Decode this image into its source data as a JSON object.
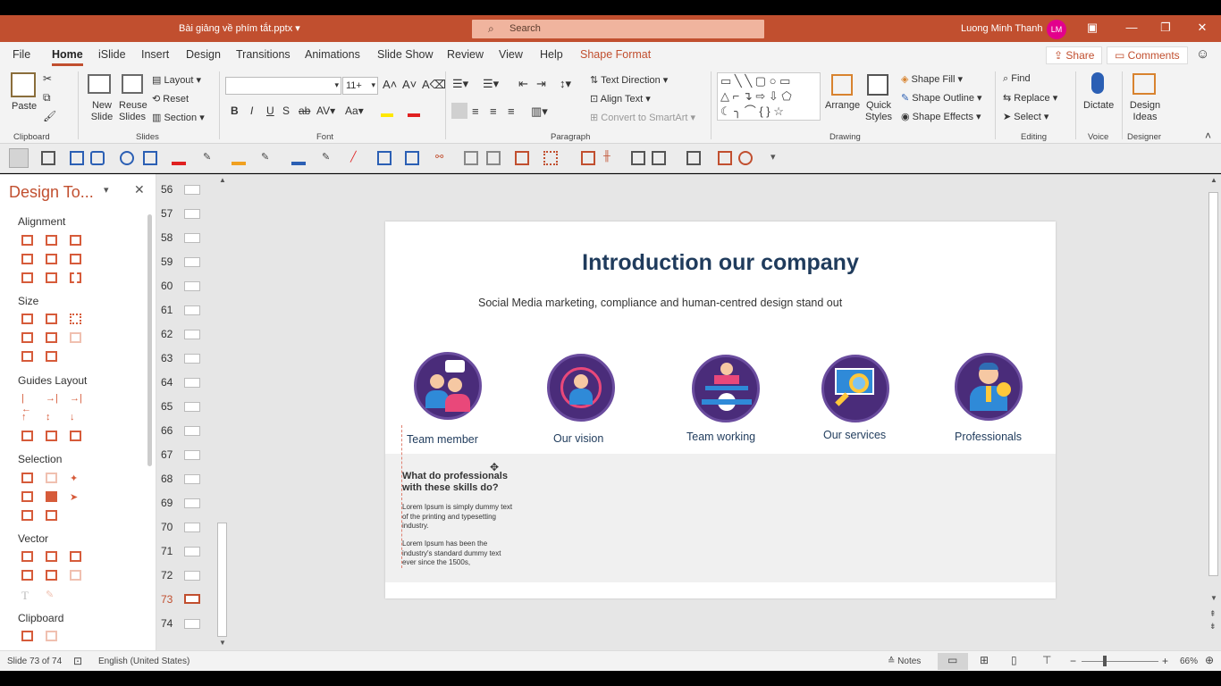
{
  "titlebar": {
    "filename": "Bài giảng về phím tắt.pptx",
    "dropdown_icon": "chevron-down-icon",
    "search_placeholder": "Search",
    "user_name": "Luong Minh Thanh",
    "user_initials": "LM",
    "accent": "#c14f2f"
  },
  "tabs": [
    "File",
    "Home",
    "iSlide",
    "Insert",
    "Design",
    "Transitions",
    "Animations",
    "Slide Show",
    "Review",
    "View",
    "Help",
    "Shape Format"
  ],
  "active_tab": "Home",
  "share_label": "Share",
  "comments_label": "Comments",
  "ribbon": {
    "clipboard": {
      "paste": "Paste",
      "group": "Clipboard"
    },
    "slides": {
      "new_slide": "New Slide",
      "reuse_slides": "Reuse Slides",
      "layout": "Layout",
      "reset": "Reset",
      "section": "Section",
      "group": "Slides"
    },
    "font": {
      "size": "11+",
      "bold": "B",
      "italic": "I",
      "underline": "U",
      "shadow": "S",
      "strike": "ab",
      "spacing": "AV",
      "case": "Aa",
      "group": "Font"
    },
    "paragraph": {
      "text_direction": "Text Direction",
      "align_text": "Align Text",
      "convert_smartart": "Convert to SmartArt",
      "group": "Paragraph"
    },
    "drawing": {
      "arrange": "Arrange",
      "quick_styles": "Quick Styles",
      "shape_fill": "Shape Fill",
      "shape_outline": "Shape Outline",
      "shape_effects": "Shape Effects",
      "group": "Drawing"
    },
    "editing": {
      "find": "Find",
      "replace": "Replace",
      "select": "Select",
      "group": "Editing"
    },
    "voice": {
      "dictate": "Dictate",
      "group": "Voice"
    },
    "designer": {
      "design_ideas": "Design Ideas",
      "group": "Designer"
    }
  },
  "design_pane": {
    "title": "Design To...",
    "sections": [
      "Alignment",
      "Size",
      "Guides Layout",
      "Selection",
      "Vector",
      "Clipboard"
    ]
  },
  "thumbnails": {
    "numbers": [
      "56",
      "57",
      "58",
      "59",
      "60",
      "61",
      "62",
      "63",
      "64",
      "65",
      "66",
      "67",
      "68",
      "69",
      "70",
      "71",
      "72",
      "73",
      "74"
    ],
    "current": "73"
  },
  "slide": {
    "title": "Introduction our company",
    "subtitle": "Social Media marketing, compliance and human-centred design stand out",
    "items": [
      "Team member",
      "Our vision",
      "Team working",
      "Our services",
      "Professionals"
    ],
    "question": "What do professionals with these skills do?",
    "para1": "Lorem Ipsum is simply dummy text of the printing and typesetting industry.",
    "para2": "Lorem Ipsum has been the industry's standard dummy text ever since the 1500s,"
  },
  "status": {
    "slide_info": "Slide 73 of 74",
    "language": "English (United States)",
    "notes": "Notes",
    "zoom": "66%"
  }
}
